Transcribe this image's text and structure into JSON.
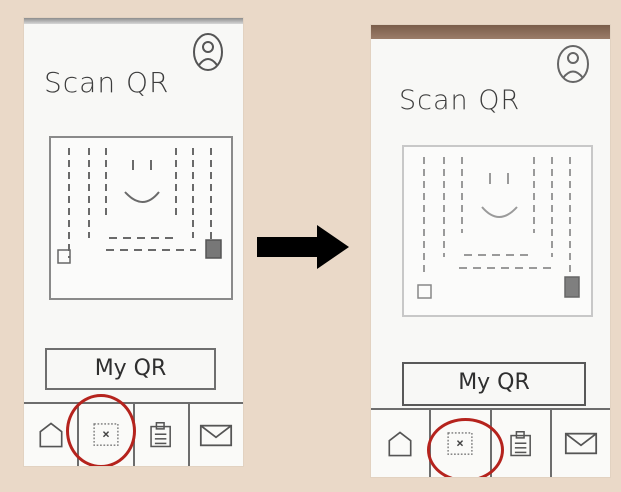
{
  "screens": [
    {
      "title": "Scan QR",
      "my_qr": "My QR",
      "tabs": [
        "home",
        "qr-code",
        "clipboard",
        "mail"
      ],
      "highlight": "qr-code"
    },
    {
      "title": "Scan QR",
      "my_qr": "My QR",
      "tabs": [
        "home",
        "qr-code",
        "clipboard",
        "mail"
      ],
      "highlight": "qr-code"
    }
  ],
  "arrow": "right-arrow",
  "colors": {
    "background": "#ead9c8",
    "sketch_paper": "#f8f8f6",
    "highlight_circle": "#b5231d",
    "arrow": "#000000"
  }
}
